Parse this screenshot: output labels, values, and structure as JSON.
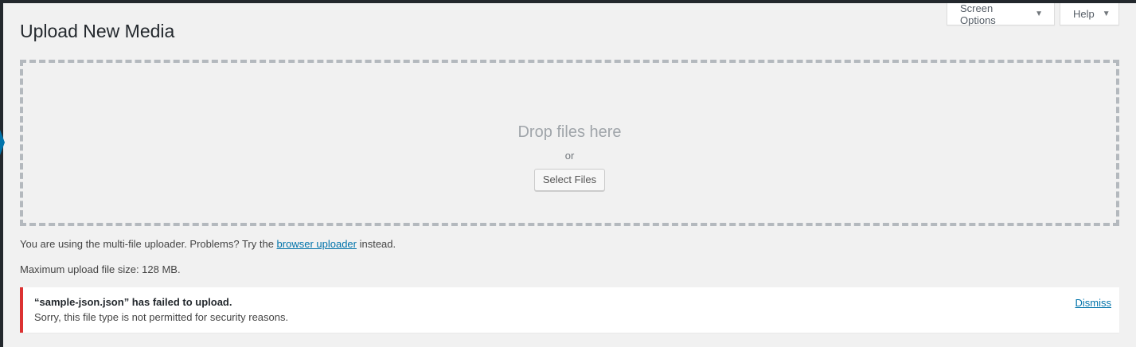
{
  "screen_meta": {
    "screen_options_label": "Screen Options",
    "help_label": "Help",
    "arrow_glyph": "▼"
  },
  "page": {
    "title": "Upload New Media"
  },
  "uploader": {
    "drop_instructions": "Drop files here",
    "or_text": "or",
    "select_files_label": "Select Files"
  },
  "help": {
    "uploader_prefix": "You are using the multi-file uploader. Problems? Try the ",
    "browser_uploader_link": "browser uploader",
    "uploader_suffix": " instead.",
    "max_size_text": "Maximum upload file size: 128 MB."
  },
  "error": {
    "title": "“sample-json.json” has failed to upload.",
    "message": "Sorry, this file type is not permitted for security reasons.",
    "dismiss_label": "Dismiss"
  },
  "colors": {
    "background": "#f1f1f1",
    "admin_bar": "#23282d",
    "link": "#0073aa",
    "error_accent": "#dc3232",
    "dashed_border": "#b4b9be"
  }
}
